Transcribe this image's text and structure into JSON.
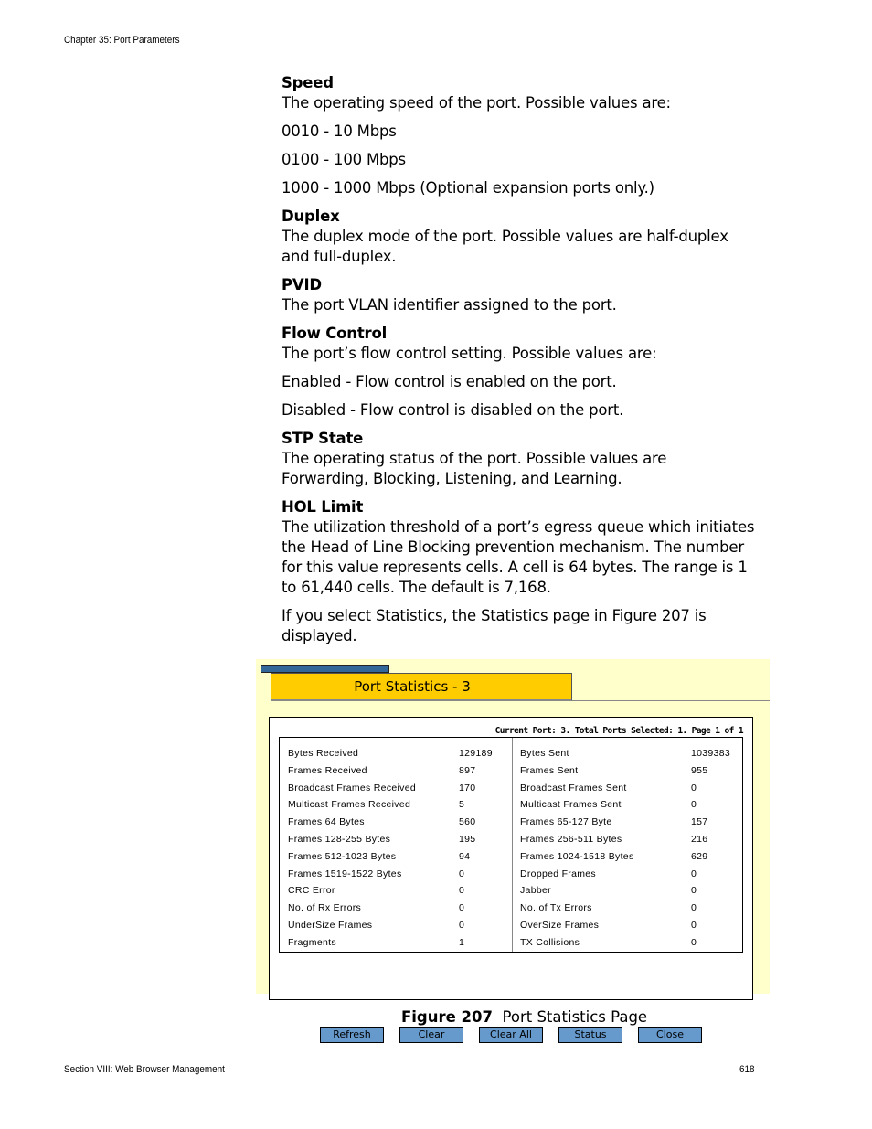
{
  "header": "Chapter 35: Port Parameters",
  "sections": [
    {
      "title": "Speed",
      "paras": [
        "The operating speed of the port. Possible values are:",
        "0010 - 10 Mbps",
        "0100 - 100 Mbps",
        "1000 - 1000 Mbps (Optional expansion ports only.)"
      ]
    },
    {
      "title": "Duplex",
      "paras": [
        "The duplex mode of the port. Possible values are half-duplex and full-duplex."
      ]
    },
    {
      "title": "PVID",
      "paras": [
        "The port VLAN identifier assigned to the port."
      ]
    },
    {
      "title": "Flow Control",
      "paras": [
        "The port’s flow control setting. Possible values are:",
        "Enabled - Flow control is enabled on the port.",
        "Disabled - Flow control is disabled on the port."
      ]
    },
    {
      "title": "STP State",
      "paras": [
        "The operating status of the port. Possible values are Forwarding, Blocking, Listening, and Learning."
      ]
    },
    {
      "title": "HOL Limit",
      "paras": [
        "The utilization threshold of a port’s egress queue which initiates the Head of Line Blocking prevention mechanism. The number for this value represents cells. A cell is 64 bytes. The range is 1 to 61,440 cells. The default is 7,168.",
        "If you select Statistics, the Statistics page in Figure 207 is displayed."
      ]
    }
  ],
  "screenshot": {
    "title": "Port Statistics - 3",
    "current": "Current Port: 3. Total Ports Selected: 1. Page 1 of 1",
    "rows": [
      [
        "Bytes Received",
        "129189",
        "Bytes Sent",
        "1039383"
      ],
      [
        "Frames Received",
        "897",
        "Frames Sent",
        "955"
      ],
      [
        "Broadcast Frames Received",
        "170",
        "Broadcast Frames Sent",
        "0"
      ],
      [
        "Multicast Frames Received",
        "5",
        "Multicast Frames Sent",
        "0"
      ],
      [
        "Frames 64 Bytes",
        "560",
        "Frames 65-127 Byte",
        "157"
      ],
      [
        "Frames 128-255 Bytes",
        "195",
        "Frames 256-511 Bytes",
        "216"
      ],
      [
        "Frames 512-1023 Bytes",
        "94",
        "Frames 1024-1518 Bytes",
        "629"
      ],
      [
        "Frames 1519-1522 Bytes",
        "0",
        "Dropped Frames",
        "0"
      ],
      [
        "CRC Error",
        "0",
        "Jabber",
        "0"
      ],
      [
        "No. of Rx Errors",
        "0",
        "No. of Tx Errors",
        "0"
      ],
      [
        "UnderSize Frames",
        "0",
        "OverSize Frames",
        "0"
      ],
      [
        "Fragments",
        "1",
        "TX Collisions",
        "0"
      ]
    ],
    "buttons": [
      "Refresh",
      "Clear",
      "Clear All",
      "Status",
      "Close"
    ],
    "colors": {
      "panel": "#ffffcc",
      "tab": "#ffcc00",
      "button": "#6699cc"
    }
  },
  "caption": {
    "label": "Figure 207",
    "text": "Port Statistics Page"
  },
  "footer": {
    "left": "Section VIII: Web Browser Management",
    "page": "618"
  }
}
